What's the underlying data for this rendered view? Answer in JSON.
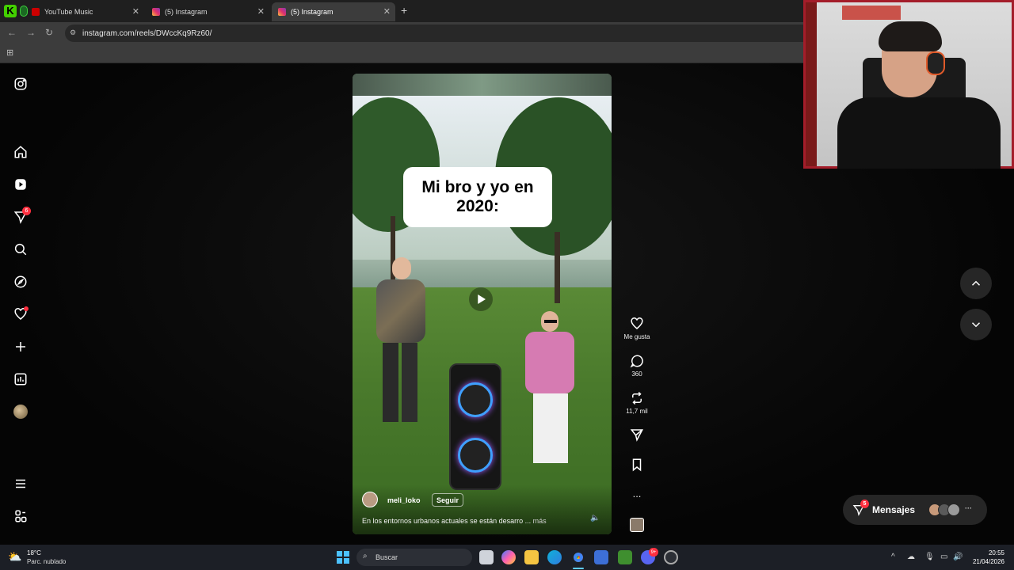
{
  "browser": {
    "tabs": [
      {
        "label": "YouTube Music",
        "active": false
      },
      {
        "label": "(5) Instagram",
        "active": false
      },
      {
        "label": "(5) Instagram",
        "active": true
      }
    ],
    "new_tab_glyph": "+",
    "url": "instagram.com/reels/DWccKq9Rz60/"
  },
  "sidebar": {
    "icons": [
      "instagram-logo-icon",
      "home-icon",
      "reels-icon",
      "messages-icon",
      "search-icon",
      "explore-icon",
      "notifications-icon",
      "create-icon",
      "dashboard-icon",
      "profile-avatar",
      "menu-icon",
      "meta-icon"
    ],
    "messages_badge": "6"
  },
  "reel": {
    "caption_card": "Mi bro y yo en 2020:",
    "username": "meli_loko",
    "follow_label": "Seguir",
    "description": "En los entornos urbanos actuales se están desarro ...",
    "more_label": "más",
    "actions": {
      "like_label": "Me gusta",
      "comments_count": "360",
      "reposts_count": "11,7 mil",
      "more_glyph": "..."
    }
  },
  "messages": {
    "label": "Mensajes",
    "badge": "5",
    "more_glyph": "···"
  },
  "taskbar": {
    "weather_temp": "18°C",
    "weather_desc": "Parc. nublado",
    "search_placeholder": "Buscar",
    "discord_badge": "9+",
    "time": "20:55",
    "date": "21/04/2026"
  },
  "colors": {
    "notification_red": "#ff3040",
    "webcam_frame": "#a41d2a",
    "taskbar_bg": "#1c1f26"
  }
}
